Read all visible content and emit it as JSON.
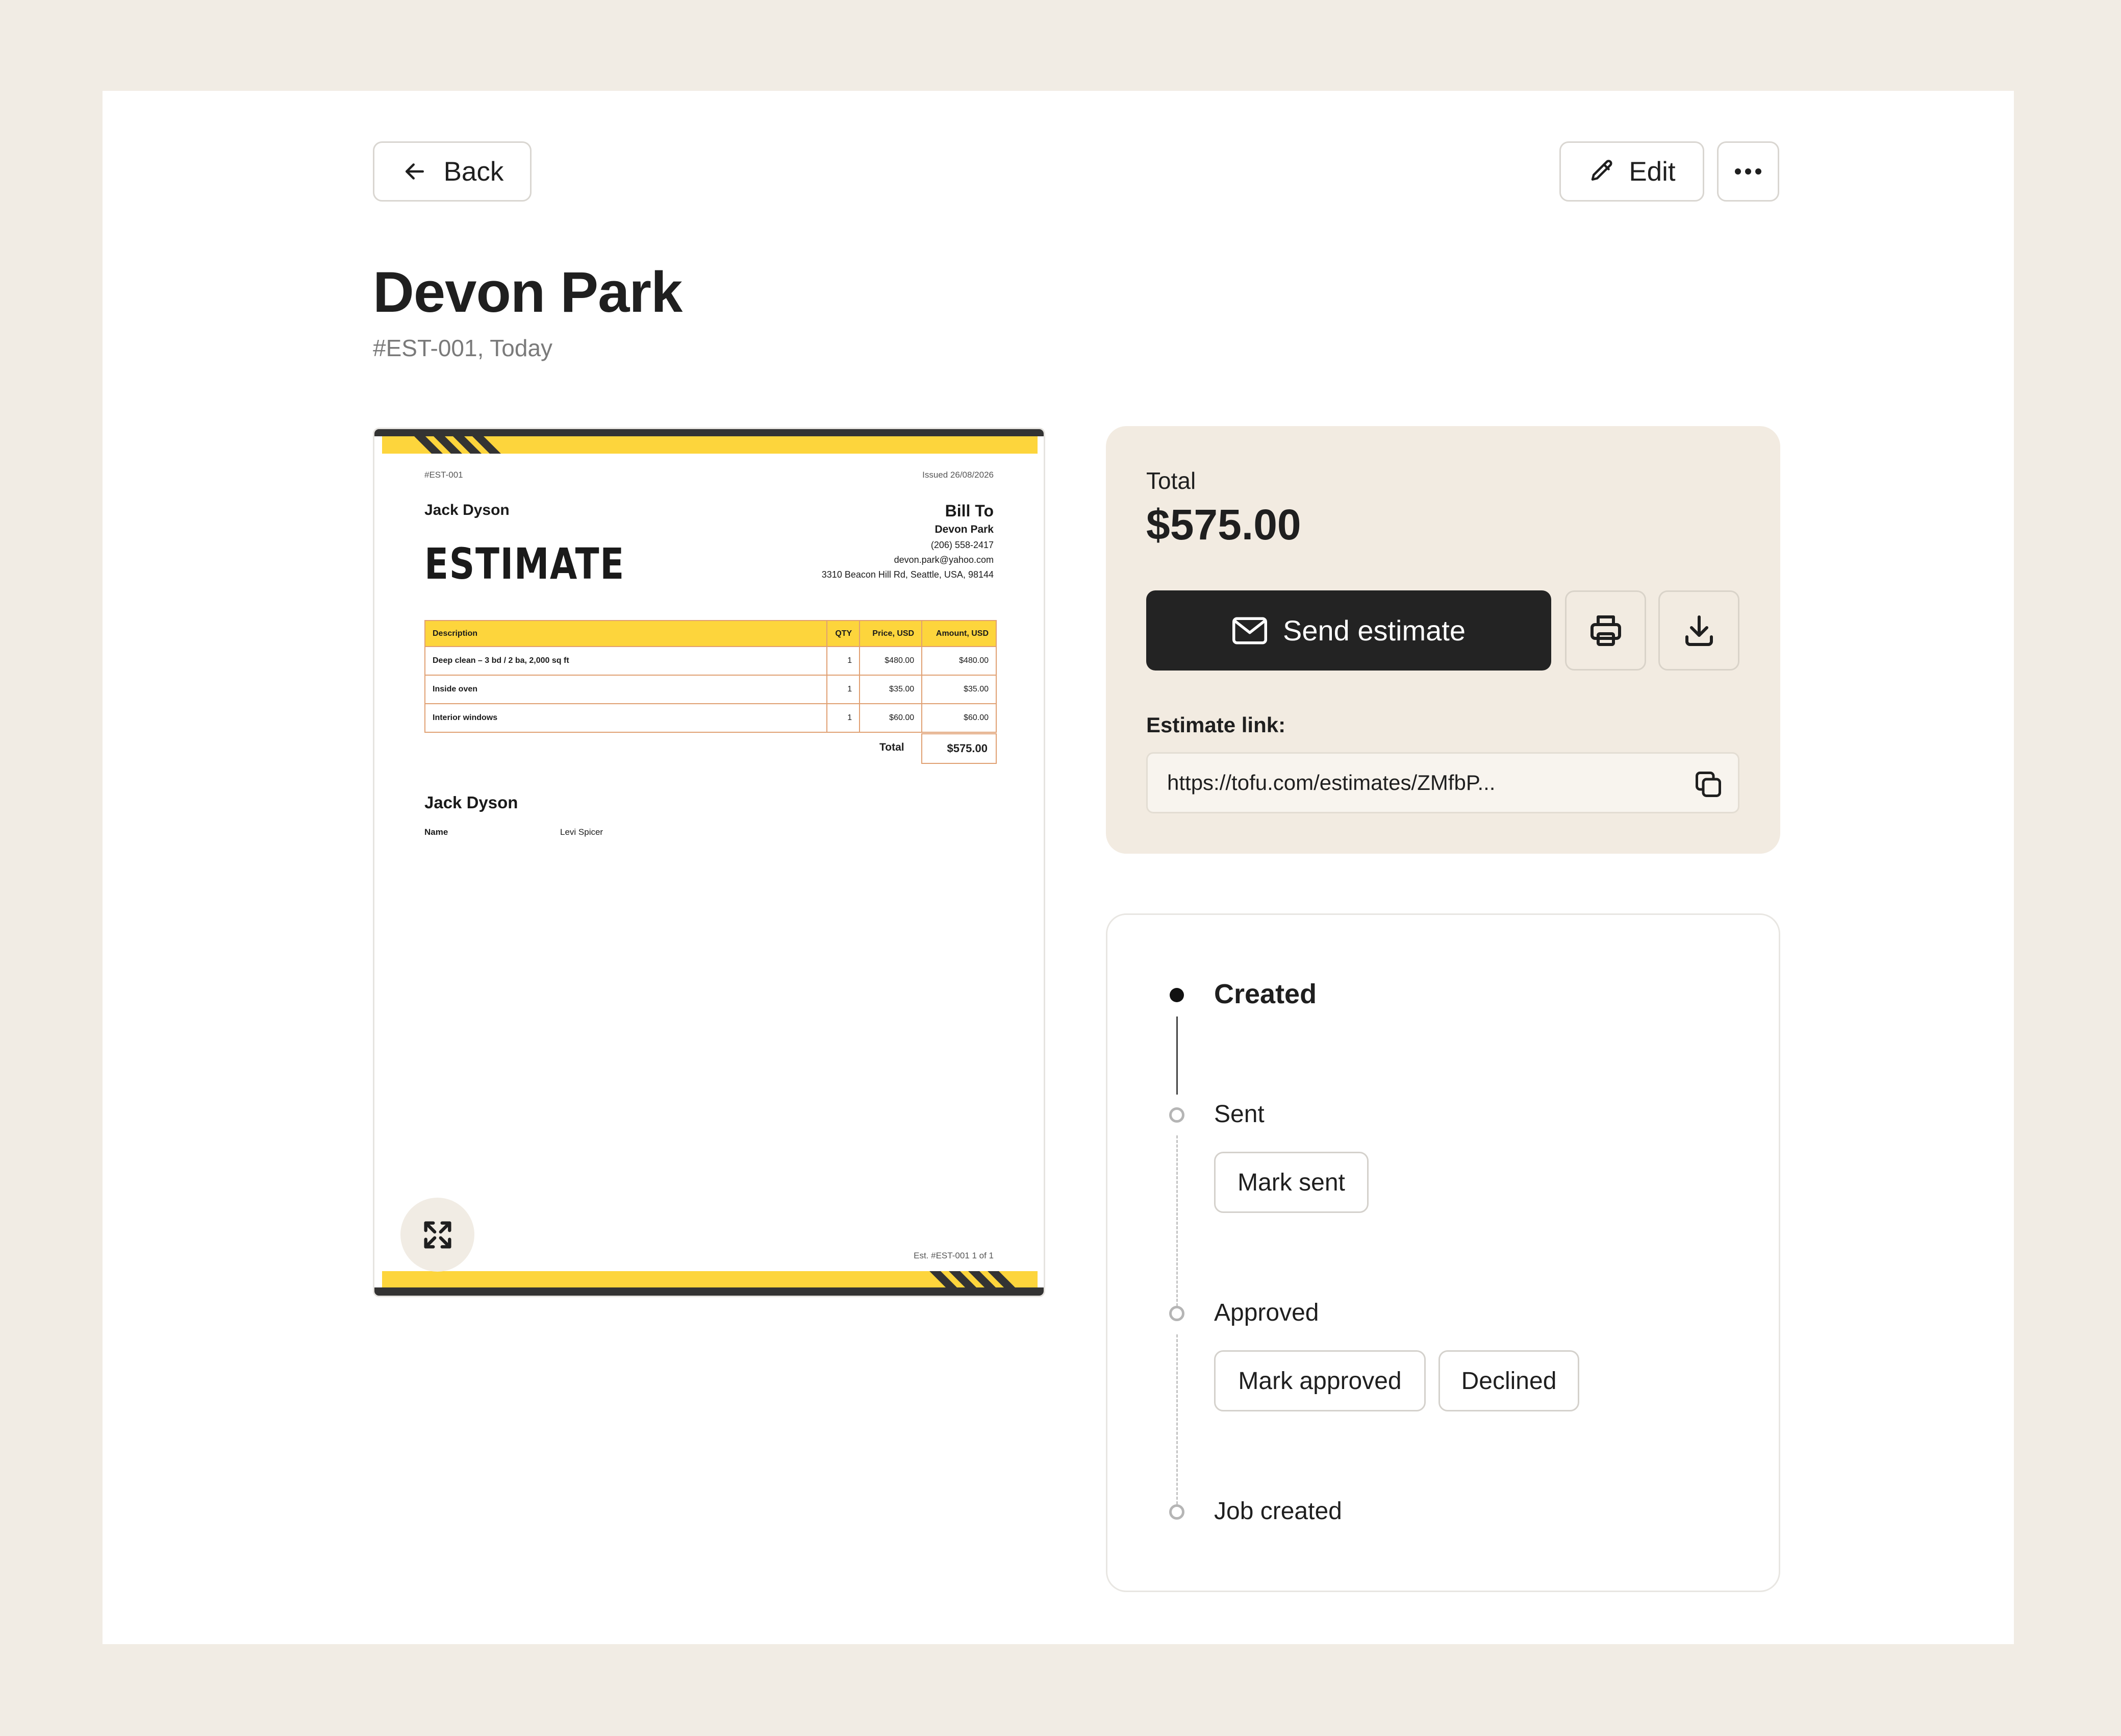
{
  "header": {
    "back_label": "Back",
    "edit_label": "Edit",
    "more_icon": "more-horizontal-icon",
    "title": "Devon Park",
    "subtitle": "#EST-001, Today"
  },
  "document": {
    "number": "#EST-001",
    "issued": "Issued 26/08/2026",
    "from_name": "Jack Dyson",
    "heading": "ESTIMATE",
    "bill_to": {
      "heading": "Bill To",
      "name": "Devon Park",
      "phone": "(206) 558-2417",
      "email": "devon.park@yahoo.com",
      "address": "3310 Beacon Hill Rd, Seattle, USA, 98144"
    },
    "table": {
      "headers": [
        "Description",
        "QTY",
        "Price, USD",
        "Amount, USD"
      ],
      "rows": [
        {
          "description": "Deep clean – 3 bd / 2 ba, 2,000 sq ft",
          "qty": "1",
          "price": "$480.00",
          "amount": "$480.00"
        },
        {
          "description": "Inside oven",
          "qty": "1",
          "price": "$35.00",
          "amount": "$35.00"
        },
        {
          "description": "Interior windows",
          "qty": "1",
          "price": "$60.00",
          "amount": "$60.00"
        }
      ],
      "total_label": "Total",
      "total_value": "$575.00"
    },
    "signature_name": "Jack Dyson",
    "name_label": "Name",
    "name_value": "Levi Spicer",
    "footer": "Est. #EST-001 1 of 1"
  },
  "summary": {
    "total_label": "Total",
    "total_value": "$575.00",
    "send_label": "Send estimate",
    "link_label": "Estimate link:",
    "link_value": "https://tofu.com/estimates/ZMfbP..."
  },
  "timeline": {
    "steps": [
      {
        "label": "Created",
        "state": "done"
      },
      {
        "label": "Sent",
        "state": "pending",
        "actions": [
          "Mark sent"
        ]
      },
      {
        "label": "Approved",
        "state": "pending",
        "actions": [
          "Mark approved",
          "Declined"
        ]
      },
      {
        "label": "Job created",
        "state": "pending"
      }
    ]
  },
  "colors": {
    "background": "#f1ece4",
    "accent_yellow": "#fdd53c",
    "dark": "#232323",
    "panel": "#f2ebe1"
  }
}
